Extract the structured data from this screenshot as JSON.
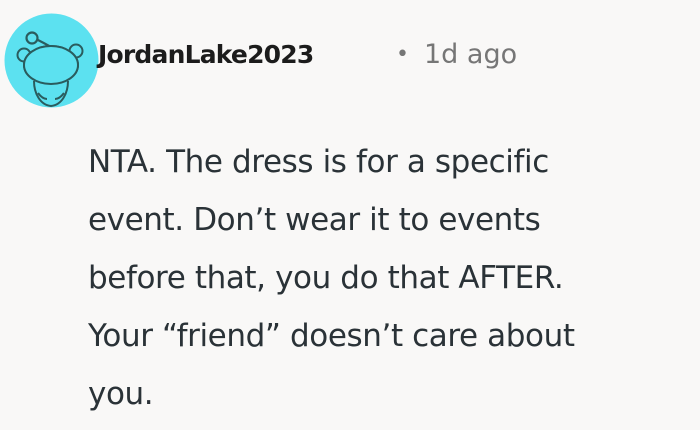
{
  "comment": {
    "author": "JordanLake2023",
    "separator": "•",
    "timestamp": "1d ago",
    "avatar_icon": "reddit-snoo-avatar",
    "avatar_bg": "#5ce1f0",
    "body_lines": [
      "NTA. The dress is for a specific",
      "event. Don’t wear it to events",
      "before that, you do that AFTER.",
      "Your “friend” doesn’t care about",
      "you."
    ]
  },
  "colors": {
    "background": "#f9f8f7",
    "text": "#2a3237",
    "meta": "#767676"
  }
}
